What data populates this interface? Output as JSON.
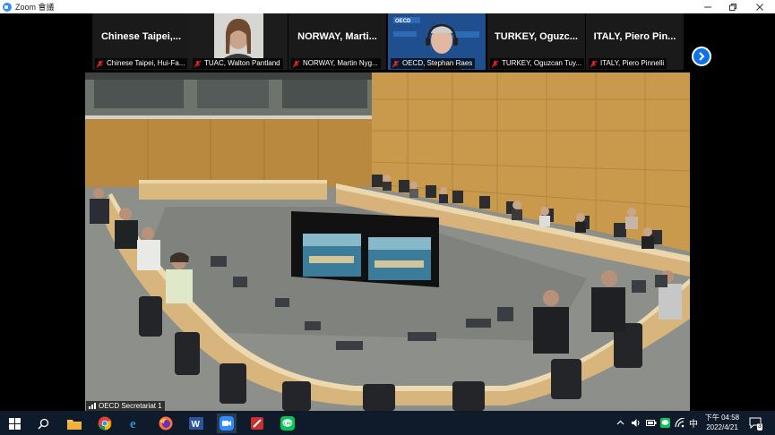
{
  "window": {
    "title": "Zoom 會議",
    "controls": [
      "minimize",
      "restore",
      "close"
    ]
  },
  "gallery": [
    {
      "name": "Chinese Taipei,...",
      "label": "Chinese Taipei, Hui-Fa...",
      "has_video": false
    },
    {
      "name": "",
      "label": "TUAC, Walton Pantland",
      "has_video": true
    },
    {
      "name": "NORWAY,  Marti...",
      "label": "NORWAY, Martin Nyg...",
      "has_video": false
    },
    {
      "name": "",
      "label": "OECD, Stephan Raes",
      "has_video": true,
      "background_text": "OECD"
    },
    {
      "name": "TURKEY,  Oguzc...",
      "label": "TURKEY, Oguzcan Tuy...",
      "has_video": false
    },
    {
      "name": "ITALY,  Piero Pin...",
      "label": "ITALY, Piero Pinnelli",
      "has_video": false
    }
  ],
  "gallery_next_icon": "chevron-right-icon",
  "main_video": {
    "speaker_label": "OECD Secretariat 1"
  },
  "taskbar": {
    "apps": [
      "windows-start-icon",
      "search-icon",
      "file-explorer-icon",
      "chrome-icon",
      "edge-icon",
      "firefox-icon",
      "word-icon",
      "zoom-icon",
      "app-icon",
      "line-icon"
    ],
    "tray": {
      "ime": "中",
      "time": "下午 04:58",
      "date": "2022/4/21",
      "notifications": "3"
    }
  },
  "colors": {
    "accent": "#2d8cff",
    "taskbar": "#0f1a2a",
    "mic_muted": "#e02828"
  }
}
